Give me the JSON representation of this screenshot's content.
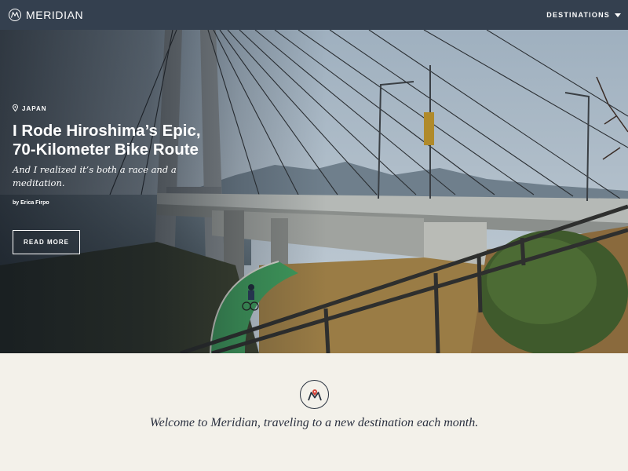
{
  "nav": {
    "brand": "MERIDIAN",
    "menu_label": "DESTINATIONS",
    "logo_icon": "meridian-logo-icon",
    "menu_icon": "caret-down-icon"
  },
  "hero": {
    "location": "JAPAN",
    "location_icon": "map-pin-icon",
    "headline": "I Rode Hiroshima’s Epic, 70-Kilometer Bike Route",
    "dek": "And I realized it’s both a race and a meditation.",
    "byline": "by Erica Firpo",
    "cta": "READ MORE"
  },
  "welcome": {
    "logo_icon": "meridian-pin-logo-icon",
    "text": "Welcome to Meridian, traveling to a new destination each month."
  },
  "colors": {
    "nav_bg": "#34404f",
    "page_bg": "#f3f1ea",
    "accent_pin": "#d6453a",
    "text_dark": "#2b3140"
  }
}
